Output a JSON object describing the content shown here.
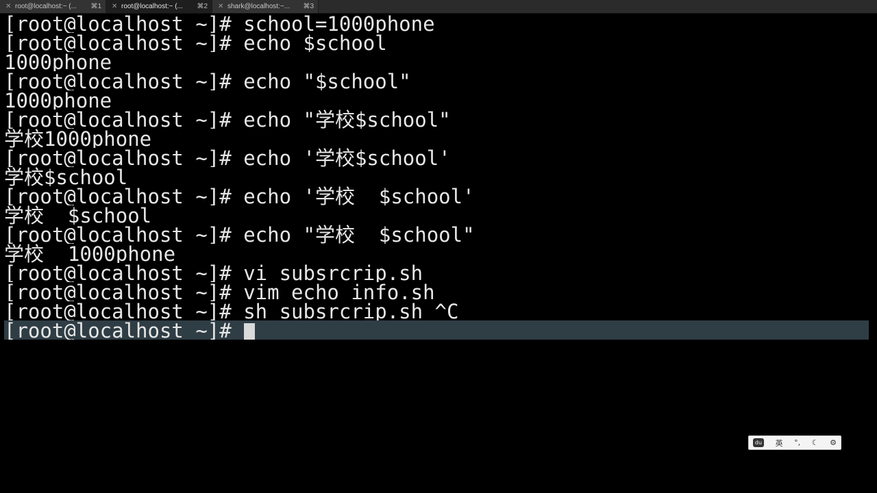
{
  "tabs": [
    {
      "title": "root@localhost:~ (...",
      "shortcut": "⌘1",
      "close": "✕"
    },
    {
      "title": "root@localhost:~ (...",
      "shortcut": "⌘2",
      "close": "✕"
    },
    {
      "title": "shark@localhost:~...",
      "shortcut": "⌘3",
      "close": "✕"
    }
  ],
  "terminal": {
    "lines": [
      "[root@localhost ~]# school=1000phone",
      "[root@localhost ~]# echo $school",
      "1000phone",
      "[root@localhost ~]# echo \"$school\"",
      "1000phone",
      "[root@localhost ~]# echo \"学校$school\"",
      "学校1000phone",
      "[root@localhost ~]# echo '学校$school'",
      "学校$school",
      "[root@localhost ~]# echo '学校  $school'",
      "学校  $school",
      "[root@localhost ~]# echo \"学校  $school\"",
      "学校  1000phone",
      "[root@localhost ~]# vi subsrcrip.sh",
      "[root@localhost ~]# vim echo_info.sh",
      "[root@localhost ~]# sh subsrcrip.sh ^C"
    ],
    "current_prompt": "[root@localhost ~]#"
  },
  "ime_toolbar": {
    "logo": "du",
    "language": "英",
    "punctuation": "°,",
    "skin": "☾",
    "settings": "⚙"
  },
  "colors": {
    "background": "#000000",
    "foreground": "#e6e6e6",
    "current_line": "#2f3d45",
    "tabbar": "#2b2b2b"
  }
}
